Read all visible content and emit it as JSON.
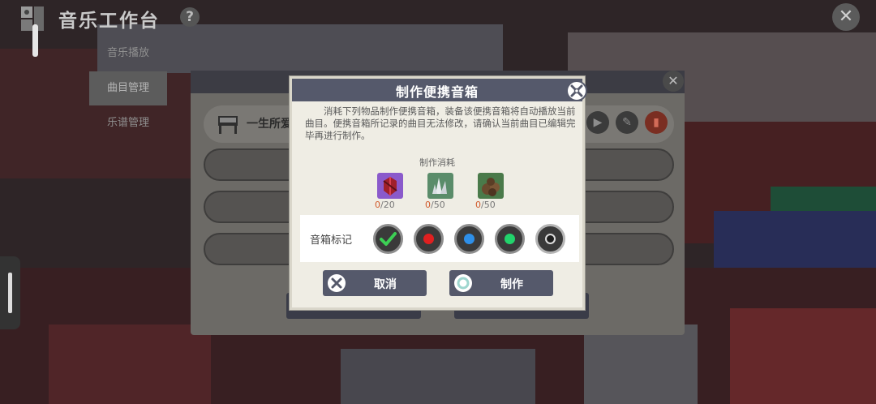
{
  "app": {
    "title": "音乐工作台",
    "help_icon": "question-icon",
    "close_icon": "close-icon"
  },
  "sidebar": {
    "items": [
      {
        "label": "音乐播放",
        "active": false
      },
      {
        "label": "曲目管理",
        "active": true
      },
      {
        "label": "乐谱管理",
        "active": false
      }
    ]
  },
  "panel": {
    "song_text": "一生所爱",
    "tool_icons": [
      "play-icon",
      "edit-icon",
      "delete-icon"
    ]
  },
  "dialog": {
    "title": "制作便携音箱",
    "description": "消耗下列物品制作便携音箱，装备该便携音箱将自动播放当前曲目。便携音箱所记录的曲目无法修改，请确认当前曲目已编辑完毕再进行制作。",
    "cost_title": "制作消耗",
    "costs": [
      {
        "icon": "red-crystal-icon",
        "have": "0",
        "need": "/20"
      },
      {
        "icon": "white-crystal-icon",
        "have": "0",
        "need": "/50"
      },
      {
        "icon": "ore-cluster-icon",
        "have": "0",
        "need": "/50"
      }
    ],
    "marker_label": "音箱标记",
    "markers": [
      {
        "name": "green-check",
        "color": "#3ccf54",
        "selected": true
      },
      {
        "name": "red",
        "color": "#e02020",
        "selected": false
      },
      {
        "name": "blue",
        "color": "#2e8fe8",
        "selected": false
      },
      {
        "name": "green",
        "color": "#22d46c",
        "selected": false
      },
      {
        "name": "gray",
        "color": "#1e1e1e",
        "selected": false
      }
    ],
    "cancel_label": "取消",
    "make_label": "制作"
  }
}
